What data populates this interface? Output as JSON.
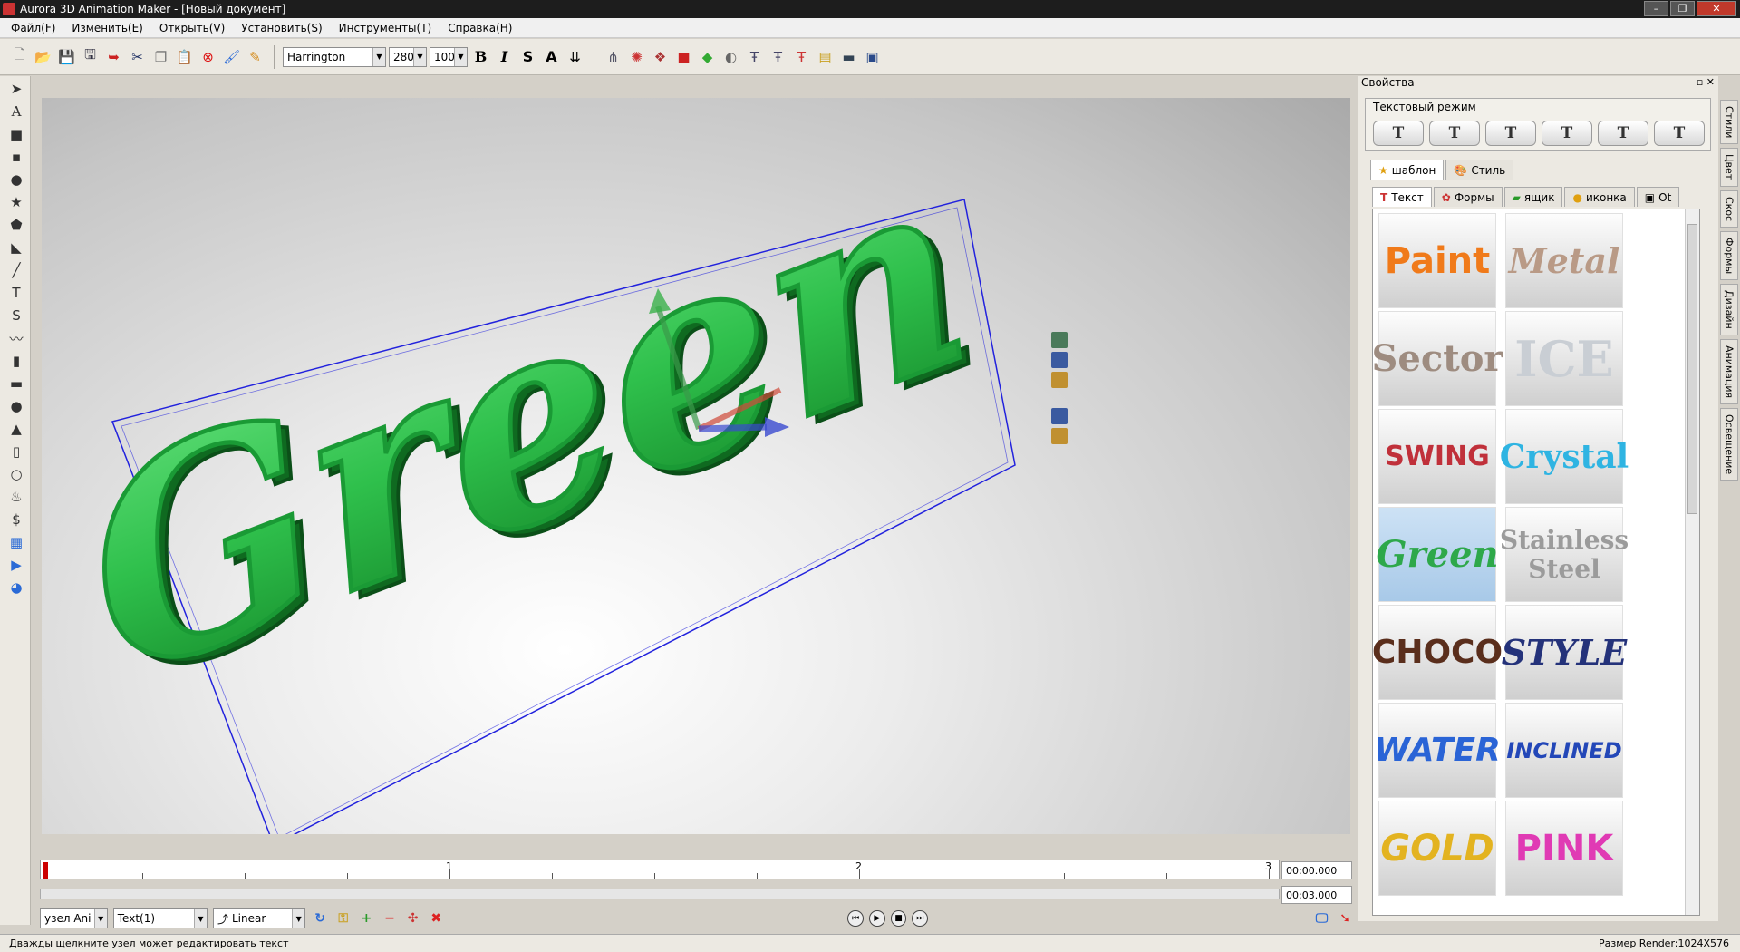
{
  "window": {
    "title": "Aurora 3D Animation Maker - [Новый документ]",
    "controls": [
      "–",
      "❐",
      "✕"
    ]
  },
  "menu": [
    "Файл(F)",
    "Изменить(E)",
    "Открыть(V)",
    "Установить(S)",
    "Инструменты(T)",
    "Справка(H)"
  ],
  "toolbar": {
    "font_name": "Harrington",
    "font_size": "280",
    "char_space": "100",
    "bold": "B",
    "italic": "I",
    "strike": "S",
    "outline": "A"
  },
  "canvas": {
    "text": "Green",
    "colors": {
      "text_fill": "#2fc04c",
      "text_dark": "#158a2a",
      "bbox": "#2222dd"
    }
  },
  "timeline": {
    "ticks": [
      "1",
      "2",
      "3"
    ],
    "current_time": "00:00.000",
    "total_time": "00:03.000"
  },
  "bottom": {
    "node": "узел Ani",
    "object": "Text(1)",
    "interpolation": "Linear"
  },
  "status": {
    "hint": "Дважды щелкните узел может редактировать текст",
    "render_size": "Размер Render:1024X576"
  },
  "properties": {
    "title": "Свойства",
    "mode_label": "Текстовый режим",
    "tabs": [
      {
        "label": "шаблон",
        "icon": "star-icon"
      },
      {
        "label": "Стиль",
        "icon": "palette-icon"
      }
    ],
    "subtabs": [
      {
        "label": "Текст",
        "icon": "text-icon"
      },
      {
        "label": "Формы",
        "icon": "shapes-icon"
      },
      {
        "label": "ящик",
        "icon": "box-icon"
      },
      {
        "label": "иконка",
        "icon": "emoji-icon"
      },
      {
        "label": "Ot",
        "icon": "film-icon"
      }
    ],
    "presets": [
      {
        "label": "Paint",
        "color": "#f07a1a"
      },
      {
        "label": "Metal",
        "color": "#b99a86"
      },
      {
        "label": "Sector",
        "color": "#9e8c80"
      },
      {
        "label": "ICE",
        "color": "#c9ced4"
      },
      {
        "label": "SWING",
        "color": "#c0303a"
      },
      {
        "label": "Crystal",
        "color": "#2fb4e2"
      },
      {
        "label": "Green",
        "color": "#2ea84a"
      },
      {
        "label": "Stainless Steel",
        "color": "#9b9b9b"
      },
      {
        "label": "CHOCO",
        "color": "#5a2e1c"
      },
      {
        "label": "STYLE",
        "color": "#24327a"
      },
      {
        "label": "WATER",
        "color": "#2a64d6"
      },
      {
        "label": "INCLINED",
        "color": "#2347b8"
      },
      {
        "label": "GOLD",
        "color": "#e3b320"
      },
      {
        "label": "PINK",
        "color": "#e03ab4"
      }
    ],
    "side_tabs": [
      "Стили",
      "Цвет",
      "Скос",
      "Формы",
      "Дизайн",
      "Анимация",
      "Освещение"
    ]
  }
}
